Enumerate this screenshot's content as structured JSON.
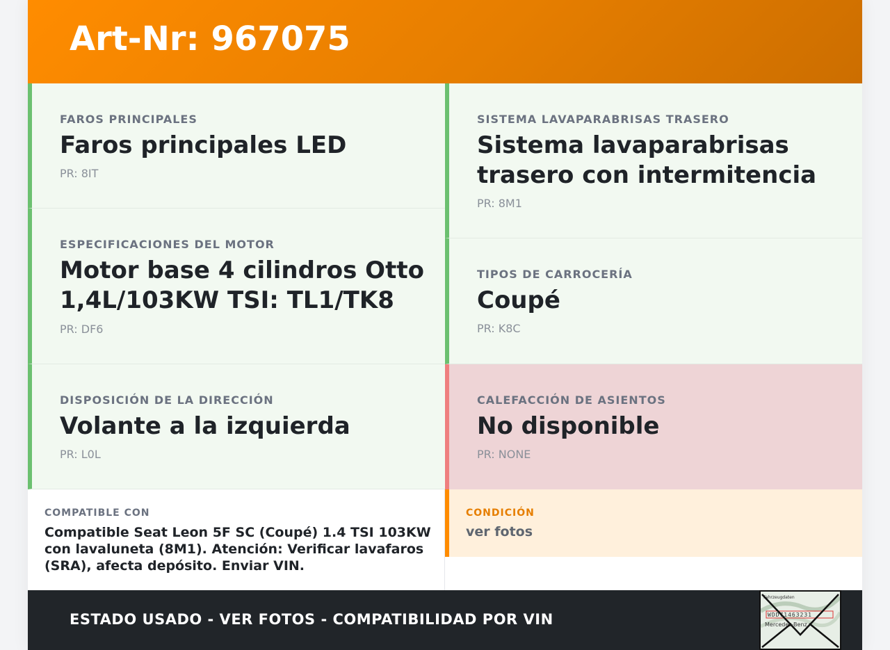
{
  "header": {
    "title": "Art-Nr: 967075"
  },
  "left_cards": [
    {
      "label": "FAROS PRINCIPALES",
      "value": "Faros principales LED",
      "code": "PR: 8IT",
      "status": "available"
    },
    {
      "label": "ESPECIFICACIONES DEL MOTOR",
      "value": "Motor base 4 cilindros Otto 1,4L/103KW TSI: TL1/TK8",
      "code": "PR: DF6",
      "status": "available"
    },
    {
      "label": "DISPOSICIÓN DE LA DIRECCIÓN",
      "value": "Volante a la izquierda",
      "code": "PR: L0L",
      "status": "available"
    }
  ],
  "right_cards": [
    {
      "label": "SISTEMA LAVAPARABRISAS TRASERO",
      "value": "Sistema lavaparabrisas trasero con intermitencia",
      "code": "PR: 8M1",
      "status": "available"
    },
    {
      "label": "TIPOS DE CARROCERÍA",
      "value": "Coupé",
      "code": "PR: K8C",
      "status": "available"
    },
    {
      "label": "CALEFACCIÓN DE ASIENTOS",
      "value": "No disponible",
      "code": "PR: NONE",
      "status": "unavailable"
    }
  ],
  "compat": {
    "label": "COMPATIBLE CON",
    "text": "Compatible Seat Leon 5F SC (Coupé) 1.4 TSI 103KW con lavaluneta (8M1). Atención: Verificar lavafaros (SRA), afecta depósito. Enviar VIN."
  },
  "condition": {
    "label": "CONDICIÓN",
    "text": "ver fotos"
  },
  "footer": {
    "text": "ESTADO USADO - VER FOTOS - COMPATIBILIDAD POR VIN"
  },
  "thumbnail": {
    "icon": "envelope-photo-icon",
    "caption": "Fahrzeugdaten",
    "code_text": "WDD71463231",
    "brand_text": "Mercedes-Benz"
  },
  "colors": {
    "header_orange": "#ff8c00",
    "available_bg": "#f2f9f1",
    "available_border": "#6cc070",
    "unavailable_bg": "#eed4d6",
    "unavailable_border": "#ef7f7f",
    "condition_bg": "#fff0dc",
    "footer_bg": "#212529"
  }
}
